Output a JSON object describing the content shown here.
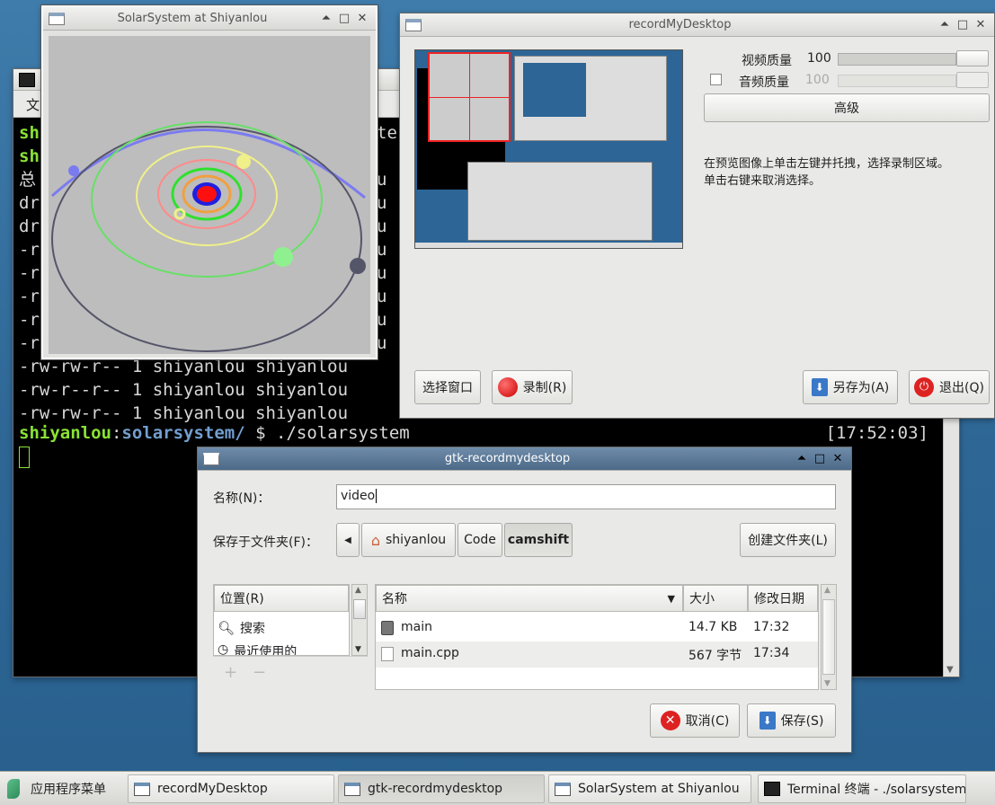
{
  "terminal": {
    "menu_label": "文",
    "lines": [
      {
        "kind": "prompt",
        "user": "sh",
        "rest": ""
      },
      {
        "kind": "prompt",
        "user": "sh",
        "rest": ""
      },
      {
        "kind": "plain",
        "text": "总"
      },
      {
        "kind": "plain",
        "text": "dr"
      },
      {
        "kind": "plain",
        "text": "dr"
      },
      {
        "kind": "plain",
        "text": "-r"
      },
      {
        "kind": "plain",
        "text": "-r"
      },
      {
        "kind": "plain",
        "text": "-r"
      },
      {
        "kind": "plain",
        "text": "-r"
      },
      {
        "kind": "plain",
        "text": "-r"
      },
      {
        "kind": "plain",
        "text": "-rw-rw-r-- 1 shiyanlou shiyanlou"
      },
      {
        "kind": "plain",
        "text": "-rw-r--r-- 1 shiyanlou shiyanlou"
      },
      {
        "kind": "plain",
        "text": "-rw-rw-r-- 1 shiyanlou shiyanlou"
      }
    ],
    "right_fragments": [
      "te",
      "u",
      "u",
      "u",
      "u",
      "u",
      "u",
      "u",
      "u"
    ],
    "prompt_user": "shiyanlou",
    "prompt_path": "solarsystem/",
    "prompt_cmd": " $ ./solarsystem",
    "clock": "[17:52:03]"
  },
  "solar_window": {
    "title": "SolarSystem at Shiyanlou"
  },
  "record_window": {
    "title": "recordMyDesktop",
    "video_quality_label": "视频质量",
    "video_quality_value": "100",
    "video_quality_level": 1.0,
    "audio_quality_label": "音频质量",
    "audio_quality_value": "100",
    "audio_checkbox_checked": false,
    "advanced_button": "高级",
    "hint_line1": "在预览图像上单击左键并托拽，选择录制区域。",
    "hint_line2": "单击右键来取消选择。",
    "select_window_button": "选择窗口",
    "record_button": "录制(R)",
    "save_as_button": "另存为(A)",
    "quit_button": "退出(Q)"
  },
  "save_dialog": {
    "title": "gtk-recordmydesktop",
    "name_label": "名称(N)：",
    "name_value": "video",
    "folder_label": "保存于文件夹(F)：",
    "breadcrumb": [
      "shiyanlou",
      "Code",
      "camshift"
    ],
    "create_folder_button": "创建文件夹(L)",
    "places_header": "位置(R)",
    "places": [
      "搜索",
      "最近使用的"
    ],
    "add_symbol": "+",
    "remove_symbol": "−",
    "columns": [
      "名称",
      "大小",
      "修改日期"
    ],
    "files": [
      {
        "name": "main",
        "size": "14.7 KB",
        "modified": "17:32",
        "icon": "executable-file-icon"
      },
      {
        "name": "main.cpp",
        "size": "567 字节",
        "modified": "17:34",
        "icon": "text-file-icon"
      }
    ],
    "cancel_button": "取消(C)",
    "save_button": "保存(S)"
  },
  "taskbar": {
    "menu_label": "应用程序菜单",
    "tasks": [
      {
        "label": "recordMyDesktop",
        "active": false
      },
      {
        "label": "gtk-recordmydesktop",
        "active": true
      },
      {
        "label": "SolarSystem at Shiyanlou",
        "active": false
      },
      {
        "label": "Terminal 终端 - ./solarsystem",
        "active": false
      }
    ]
  },
  "colors": {
    "desktop": "#2e6796",
    "terminal_green": "#8ae234",
    "terminal_blue": "#729fcf",
    "record_red": "#d11"
  }
}
